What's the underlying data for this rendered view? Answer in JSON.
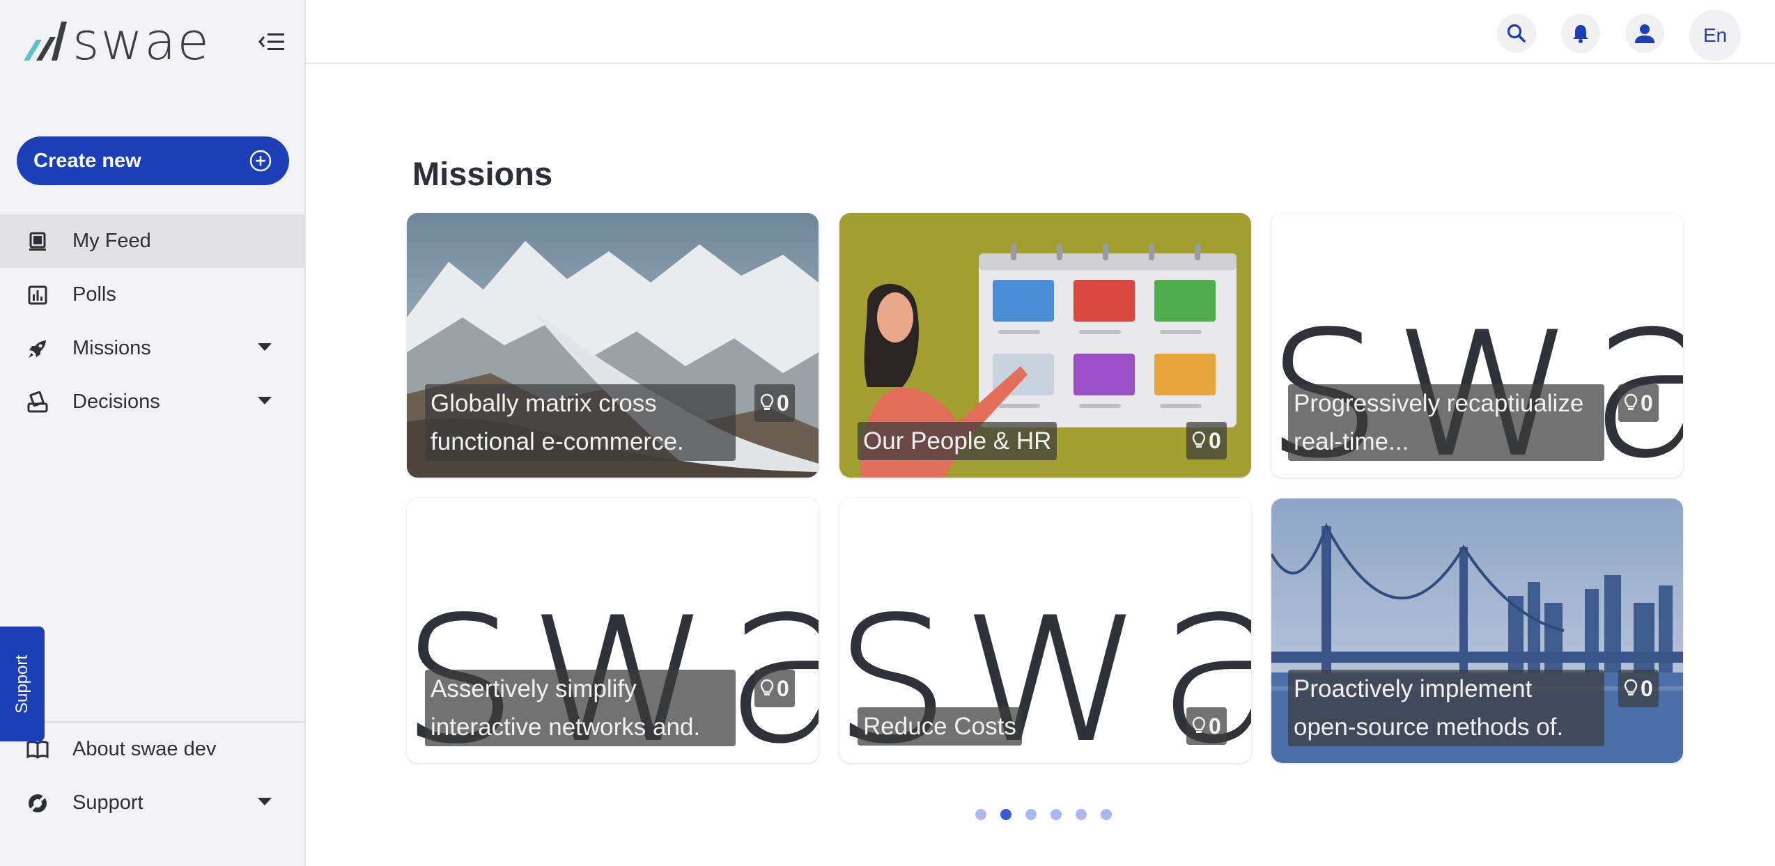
{
  "brand": {
    "name": "swae"
  },
  "sidebar": {
    "create_label": "Create new",
    "items": [
      {
        "label": "My Feed",
        "active": true
      },
      {
        "label": "Polls"
      },
      {
        "label": "Missions",
        "has_dropdown": true
      },
      {
        "label": "Decisions",
        "has_dropdown": true
      }
    ],
    "bottom_items": [
      {
        "label": "About swae dev"
      },
      {
        "label": "Support",
        "has_dropdown": true
      }
    ],
    "support_tab": "Support"
  },
  "header": {
    "language": "En"
  },
  "main": {
    "title": "Missions",
    "cards": [
      {
        "caption": "Globally matrix cross functional e-commerce.",
        "count": "0",
        "image": "mountain-glacier-photo"
      },
      {
        "caption": "Our People & HR",
        "count": "0",
        "image": "people-hr-illustration"
      },
      {
        "caption": "Progressively recaptiualize real-time...",
        "count": "0",
        "image": "swae-placeholder"
      },
      {
        "caption": "Assertively simplify interactive networks and.",
        "count": "0",
        "image": "swae-placeholder"
      },
      {
        "caption": "Reduce Costs",
        "count": "0",
        "image": "swae-placeholder"
      },
      {
        "caption": "Proactively implement open-source methods of.",
        "count": "0",
        "image": "bridge-city-photo"
      }
    ],
    "pagination": {
      "total": 6,
      "active_index": 1
    }
  },
  "colors": {
    "accent": "#1c3fb7",
    "sidebar_bg": "#f3f3f5"
  }
}
